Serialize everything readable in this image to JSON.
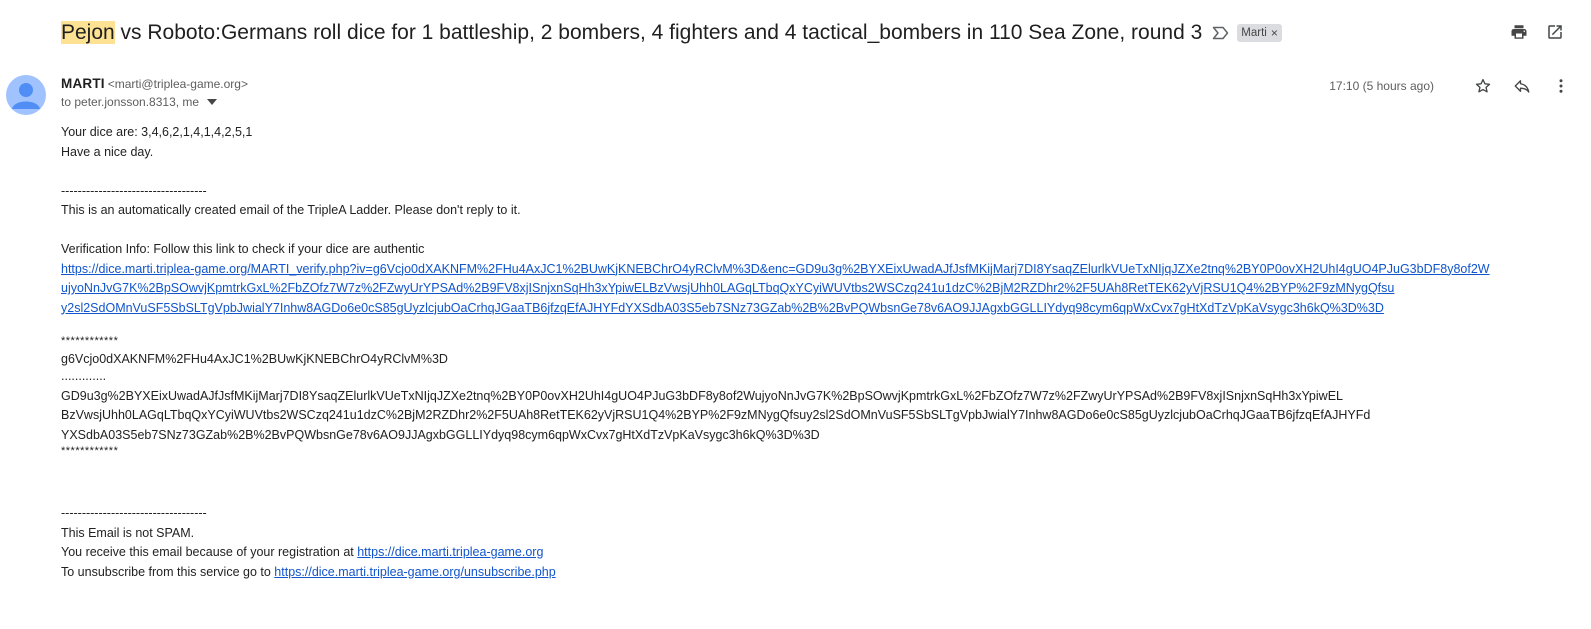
{
  "subject": {
    "highlighted": "Pejon",
    "rest": " vs Roboto:Germans roll dice for 1 battleship, 2 bombers, 4 fighters and 4 tactical_bombers in 110 Sea Zone, round 3",
    "label": "Marti",
    "label_close": "×"
  },
  "top_actions": {
    "print_icon": "print-icon",
    "popout_icon": "open-in-new-window-icon"
  },
  "sender": {
    "name": "MARTI",
    "email": "<marti@triplea-game.org>",
    "to": "to peter.jonsson.8313, me"
  },
  "message_actions": {
    "timestamp": "17:10 (5 hours ago)",
    "star_icon": "star-icon",
    "reply_icon": "reply-icon",
    "more_icon": "more-vert-icon"
  },
  "body": {
    "dice_line": "Your dice are: 3,4,6,2,1,4,1,4,2,5,1",
    "nice_day": "Have a nice day.",
    "separator": "-----------------------------------",
    "auto_notice": "This is an automatically created email of the TripleA Ladder. Please don't reply to it.",
    "verification_intro": "Verification Info: Follow this link to check if your dice are authentic",
    "verify_link_lines": [
      "https://dice.marti.triplea-game.org/MARTI_verify.php?iv=g6Vcjo0dXAKNFM%2FHu4AxJC1%2BUwKjKNEBChrO4yRClvM%3D&enc=GD9u3g%2BYXEixUwadAJfJsfMKijMarj7DI8YsaqZElurlkVUeTxNIjqJZXe2tnq%2BY0P0ovXH2UhI4gUO4PJuG3bDF8y8of2W",
      "ujyoNnJvG7K%2BpSOwvjKpmtrkGxL%2FbZOfz7W7z%2FZwyUrYPSAd%2B9FV8xjISnjxnSqHh3xYpiwELBzVwsjUhh0LAGqLTbqQxYCyiWUVtbs2WSCzq241u1dzC%2BjM2RZDhr2%2F5UAh8RetTEK62yVjRSU1Q4%2BYP%2F9zMNygQfsu",
      "y2sl2SdOMnVuSF5SbSLTgVpbJwialY7Inhw8AGDo6e0cS85gUyzlcjubOaCrhqJGaaTB6jfzqEfAJHYFdYXSdbA03S5eb7SNz73GZab%2B%2BvPQWbsnGe78v6AO9JJAgxbGGLLIYdyq98cym6qpWxCvx7gHtXdTzVpKaVsygc3h6kQ%3D%3D"
    ],
    "stars": "************",
    "iv_value": "g6Vcjo0dXAKNFM%2FHu4AxJC1%2BUwKjKNEBChrO4yRClvM%3D",
    "dots": ".............",
    "enc_lines": [
      "GD9u3g%2BYXEixUwadAJfJsfMKijMarj7DI8YsaqZElurlkVUeTxNIjqJZXe2tnq%2BY0P0ovXH2UhI4gUO4PJuG3bDF8y8of2WujyoNnJvG7K%2BpSOwvjKpmtrkGxL%2FbZOfz7W7z%2FZwyUrYPSAd%2B9FV8xjISnjxnSqHh3xYpiwEL",
      "BzVwsjUhh0LAGqLTbqQxYCyiWUVtbs2WSCzq241u1dzC%2BjM2RZDhr2%2F5UAh8RetTEK62yVjRSU1Q4%2BYP%2F9zMNygQfsuy2sl2SdOMnVuSF5SbSLTgVpbJwialY7Inhw8AGDo6e0cS85gUyzlcjubOaCrhqJGaaTB6jfzqEfAJHYFd",
      "YXSdbA03S5eb7SNz73GZab%2B%2BvPQWbsnGe78v6AO9JJAgxbGGLLIYdyq98cym6qpWxCvx7gHtXdTzVpKaVsygc3h6kQ%3D%3D"
    ],
    "not_spam": "This Email is not SPAM.",
    "registration_text": "You receive this email because of your registration at ",
    "registration_link": "https://dice.marti.triplea-game.org",
    "unsubscribe_text": "To unsubscribe from this service go to ",
    "unsubscribe_link": "https://dice.marti.triplea-game.org/unsubscribe.php"
  }
}
